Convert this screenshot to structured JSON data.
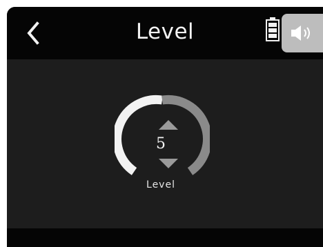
{
  "header": {
    "title": "Level"
  },
  "level_control": {
    "value": "5",
    "label": "Level",
    "fill_fraction": 0.5
  },
  "icons": {
    "back": "chevron-left-icon",
    "battery": "battery-icon",
    "speaker": "speaker-icon",
    "up": "triangle-up-icon",
    "down": "triangle-down-icon"
  },
  "colors": {
    "background": "#050505",
    "panel": "#1d1d1d",
    "arc_filled": "#f2f2f2",
    "arc_empty": "#8a8a8a",
    "arrow": "#9a9a9a",
    "speaker_tab": "#bdbdbd"
  }
}
